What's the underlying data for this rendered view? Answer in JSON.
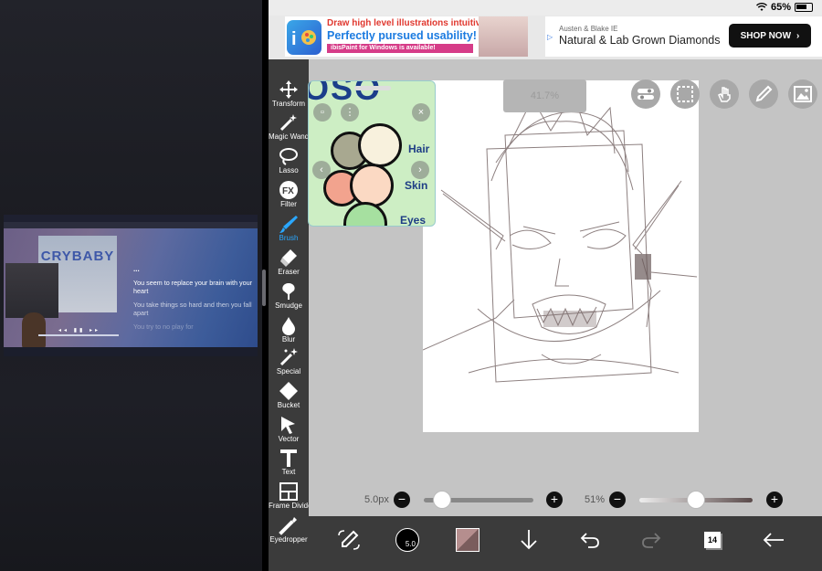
{
  "status_bar": {
    "battery": "65%"
  },
  "ad": {
    "left_line1": "Draw high level illustrations intuitively!",
    "left_line2": "Perfectly pursued usability!",
    "left_line3": "ibisPaint for Windows is available!",
    "right_brand": "Austen & Blake IE",
    "right_headline": "Natural & Lab Grown Diamonds",
    "cta": "SHOP NOW"
  },
  "mini_window": {
    "cover_title": "CRYBABY",
    "lyric_dots": "...",
    "lyric1": "You seem to replace your brain with your heart",
    "lyric2": "You take things so hard and then you fall apart",
    "lyric3": "You try to no play for"
  },
  "toolbar": {
    "tools": [
      {
        "label": "Transform",
        "icon": "move-icon"
      },
      {
        "label": "Magic Wand",
        "icon": "magic-wand-icon"
      },
      {
        "label": "Lasso",
        "icon": "lasso-icon"
      },
      {
        "label": "Filter",
        "icon": "fx-icon"
      },
      {
        "label": "Brush",
        "icon": "brush-icon",
        "active": true
      },
      {
        "label": "Eraser",
        "icon": "eraser-icon"
      },
      {
        "label": "Smudge",
        "icon": "smudge-icon"
      },
      {
        "label": "Blur",
        "icon": "blur-drop-icon"
      },
      {
        "label": "Special",
        "icon": "special-icon"
      },
      {
        "label": "Bucket",
        "icon": "bucket-icon"
      },
      {
        "label": "Vector",
        "icon": "vector-arrow-icon"
      },
      {
        "label": "Text",
        "icon": "text-icon"
      },
      {
        "label": "Frame Divider",
        "icon": "frame-divider-icon"
      },
      {
        "label": "Eyedropper",
        "icon": "eyedropper-icon"
      }
    ],
    "active_color": "#2aa7ff"
  },
  "canvas": {
    "zoom": "41.7%",
    "color_panel": {
      "labels": {
        "hair": "Hair",
        "skin": "Skin",
        "eyes": "Eyes"
      },
      "title_fragment": "OSO",
      "swatches": [
        "#a8a890",
        "#f8f1dd",
        "#f2a38e",
        "#fbd9c3",
        "#a6e0a0"
      ]
    }
  },
  "brush": {
    "size": "5.0px",
    "opacity": "51%",
    "size_fraction": 0.16,
    "opacity_fraction": 0.5
  },
  "bottom_bar": {
    "brush_size_label": "5.0",
    "layers": "14"
  }
}
